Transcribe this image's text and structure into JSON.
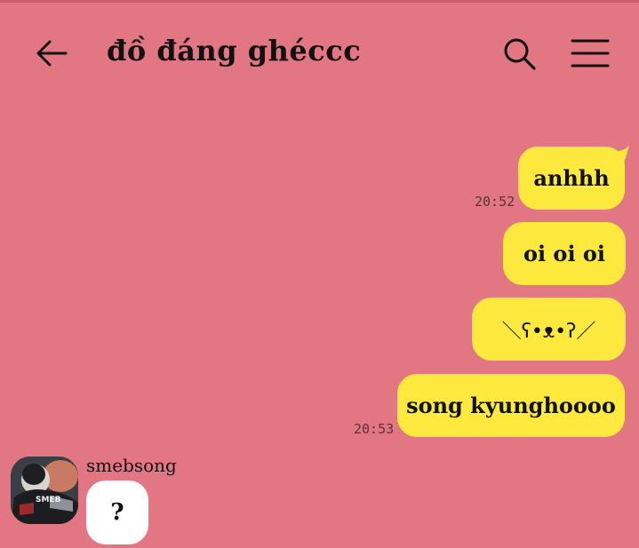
{
  "header": {
    "title": "đồ đáng ghéccc",
    "back_icon": "arrow-left-icon",
    "search_icon": "search-icon",
    "menu_icon": "hamburger-menu-icon"
  },
  "messages_outgoing": [
    {
      "text": "anhhh",
      "time": "20:52"
    },
    {
      "text": "oi oi oi"
    },
    {
      "text": "＼ʕ•ᴥ•ʔ／"
    },
    {
      "text": "song kyunghoooo",
      "time": "20:53"
    }
  ],
  "message_incoming": {
    "sender": "smebsong",
    "text": "?",
    "avatar_text": "SMEB"
  },
  "colors": {
    "background": "#e27783",
    "outgoing_bubble": "#fde93d",
    "incoming_bubble": "#ffffff"
  }
}
